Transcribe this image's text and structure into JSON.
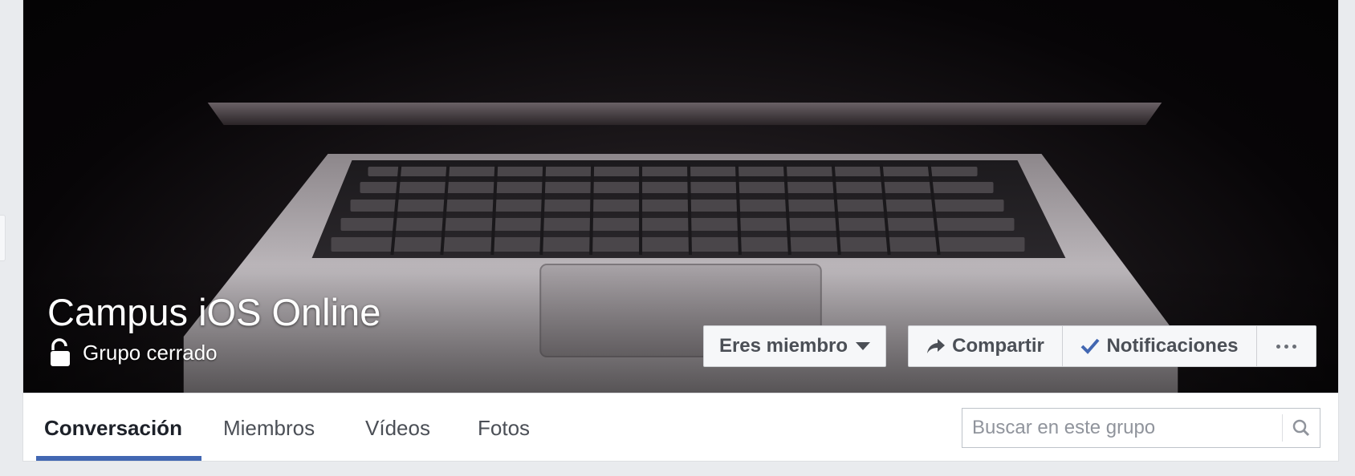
{
  "group": {
    "name": "Campus iOS Online",
    "privacy": "Grupo cerrado"
  },
  "actions": {
    "member_label": "Eres miembro",
    "share_label": "Compartir",
    "notifications_label": "Notificaciones"
  },
  "tabs": [
    {
      "label": "Conversación",
      "active": true
    },
    {
      "label": "Miembros",
      "active": false
    },
    {
      "label": "Vídeos",
      "active": false
    },
    {
      "label": "Fotos",
      "active": false
    }
  ],
  "search": {
    "placeholder": "Buscar en este grupo"
  },
  "icons": {
    "privacy": "unlocked-padlock-icon",
    "member_dropdown": "caret-down-icon",
    "share": "share-arrow-icon",
    "notifications": "checkmark-icon",
    "more": "more-dots-icon",
    "search": "magnifier-icon"
  },
  "colors": {
    "accent": "#4267b2",
    "button_bg": "#f6f7f9",
    "button_text": "#4b4f56",
    "page_bg": "#e9ebee",
    "checkmark": "#4267b2"
  }
}
